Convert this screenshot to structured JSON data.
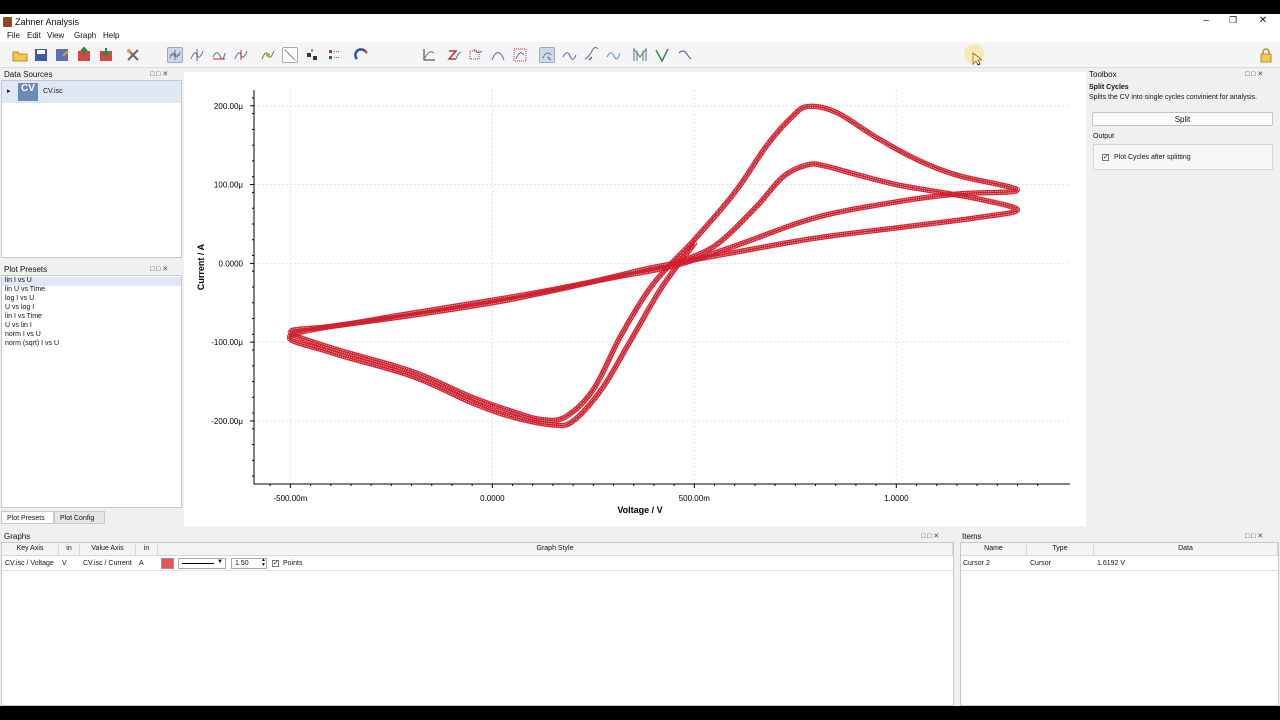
{
  "window": {
    "title": "Zahner Analysis"
  },
  "menu": [
    "File",
    "Edit",
    "View",
    "Graph",
    "Help"
  ],
  "data_sources": {
    "title": "Data Sources",
    "items": [
      {
        "icon_label": "CV",
        "name": "CV.isc"
      }
    ]
  },
  "plot_presets": {
    "title": "Plot Presets",
    "items": [
      "lin I vs U",
      "lin U vs Time",
      "log I vs U",
      "U vs log I",
      "lin I vs Time",
      "U vs lin I",
      "norm I vs U",
      "norm (sqrt) I vs U"
    ],
    "tabs": [
      "Plot Presets",
      "Plot Config"
    ]
  },
  "toolbox": {
    "title": "Toolbox",
    "heading": "Split Cycles",
    "description": "Splits the CV into single cycles convinient for analysis.",
    "split_label": "Split",
    "output_label": "Output",
    "checkbox_label": "Plot Cycles after splitting",
    "checkbox_checked": true
  },
  "graphs": {
    "title": "Graphs",
    "columns": [
      "Key Axis",
      "in",
      "Value Axis",
      "in",
      "Graph Style"
    ],
    "row": {
      "key_axis": "CV.isc / Voltage",
      "key_unit": "V",
      "value_axis": "CV.isc / Current",
      "value_unit": "A",
      "color": "#e8535b",
      "line_width": "1.50",
      "points_label": "Points",
      "points_checked": true
    }
  },
  "items": {
    "title": "Items",
    "columns": [
      "Name",
      "Type",
      "Data"
    ],
    "rows": [
      {
        "name": "Cursor 2",
        "type": "Cursor",
        "data": "1.6192 V"
      }
    ]
  },
  "icons": [
    "save-icon",
    "cursor-icon",
    "zoom-icon",
    "lock-icon",
    "magnet-icon",
    "peak-icon"
  ],
  "chart_data": {
    "type": "line",
    "xlabel": "Voltage / V",
    "ylabel": "Current / A",
    "x_ticks": [
      "-500.00m",
      "0.0000",
      "500.00m",
      "1.0000"
    ],
    "y_ticks": [
      "200.00μ",
      "100.00μ",
      "0.0000",
      "-100.00μ",
      "-200.00μ"
    ],
    "xlim": [
      -0.59,
      1.43
    ],
    "ylim": [
      -0.00028,
      0.00022
    ],
    "grid": true,
    "series_color": "#d0202e",
    "series": [
      {
        "values": [
          [
            0.45,
            0.0
          ],
          [
            0.55,
            2.2e-05
          ],
          [
            0.65,
            7e-05
          ],
          [
            0.72,
            0.00011
          ],
          [
            0.78,
            0.000125
          ],
          [
            0.82,
            0.000124
          ],
          [
            0.9,
            0.000113
          ],
          [
            1.0,
            0.0001
          ],
          [
            1.1,
            9.1e-05
          ],
          [
            1.2,
            8.2e-05
          ],
          [
            1.3,
            6.8e-05
          ],
          [
            1.2,
            5.8e-05
          ],
          [
            1.0,
            4.5e-05
          ],
          [
            0.8,
            3.2e-05
          ],
          [
            0.6,
            1.4e-05
          ],
          [
            0.4,
            -5e-06
          ],
          [
            0.3,
            -1.7e-05
          ],
          [
            0.2,
            -2.9e-05
          ],
          [
            0.1,
            -4e-05
          ],
          [
            0.0,
            -5e-05
          ],
          [
            -0.2,
            -6.6e-05
          ],
          [
            -0.4,
            -8e-05
          ],
          [
            -0.5,
            -8.7e-05
          ],
          [
            -0.4,
            -0.000107
          ],
          [
            -0.2,
            -0.000137
          ],
          [
            -0.05,
            -0.00017
          ],
          [
            0.05,
            -0.000188
          ],
          [
            0.12,
            -0.000198
          ],
          [
            0.18,
            -0.000195
          ],
          [
            0.25,
            -0.00016
          ],
          [
            0.32,
            -9e-05
          ],
          [
            0.4,
            -2.5e-05
          ],
          [
            0.5,
            3e-05
          ],
          [
            0.6,
            9e-05
          ],
          [
            0.68,
            0.00015
          ],
          [
            0.74,
            0.000185
          ],
          [
            0.78,
            0.000199
          ],
          [
            0.85,
            0.000192
          ],
          [
            0.95,
            0.00016
          ],
          [
            1.05,
            0.000132
          ],
          [
            1.15,
            0.000112
          ],
          [
            1.3,
            9.3e-05
          ],
          [
            1.15,
            8.8e-05
          ],
          [
            1.0,
            7.8e-05
          ],
          [
            0.8,
            5.8e-05
          ],
          [
            0.6,
            2.2e-05
          ],
          [
            0.45,
            -3e-06
          ],
          [
            0.3,
            -1.8e-05
          ],
          [
            0.1,
            -3.8e-05
          ],
          [
            -0.1,
            -5.5e-05
          ],
          [
            -0.3,
            -7.2e-05
          ],
          [
            -0.5,
            -9.2e-05
          ],
          [
            -0.4,
            -0.000113
          ],
          [
            -0.2,
            -0.000143
          ],
          [
            -0.05,
            -0.000177
          ],
          [
            0.05,
            -0.000195
          ],
          [
            0.15,
            -0.000205
          ],
          [
            0.2,
            -0.0002
          ],
          [
            0.27,
            -0.00016
          ],
          [
            0.34,
            -0.0001
          ],
          [
            0.42,
            -3e-05
          ],
          [
            0.5,
            2.5e-05
          ]
        ]
      }
    ]
  }
}
